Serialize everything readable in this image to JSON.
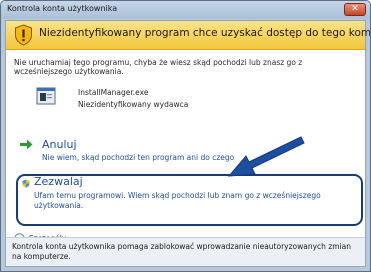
{
  "window": {
    "title": "Kontrola konta użytkownika",
    "close_label": "✕"
  },
  "header": {
    "text": "Niezidentyfikowany program chce uzyskać dostęp do tego komputera",
    "icon": "shield-warning-icon"
  },
  "intro": {
    "text": "Nie uruchamiaj tego programu, chyba że wiesz skąd pochodzi lub znasz go z wcześniejszego użytkowania."
  },
  "program": {
    "name": "InstallManager.exe",
    "publisher": "Niezidentyfikowany wydawca",
    "icon": "program-icon"
  },
  "options": {
    "cancel": {
      "title": "Anuluj",
      "description": "Nie wiem, skąd pochodzi ten program ani do czego",
      "icon": "arrow-right-icon"
    },
    "allow": {
      "title": "Zezwalaj",
      "description": "Ufam temu programowi. Wiem skąd pochodzi lub znam go z wcześniejszego użytkowania.",
      "icon": "shield-icon"
    }
  },
  "details": {
    "label": "Szczegóły"
  },
  "footer": {
    "text": "Kontrola konta użytkownika pomaga zablokować wprowadzanie nieautoryzowanych zmian na komputerze."
  },
  "colors": {
    "link_blue": "#1f4e9c",
    "header_yellow": "#f2c73c",
    "highlight_border": "#1b3b78"
  }
}
